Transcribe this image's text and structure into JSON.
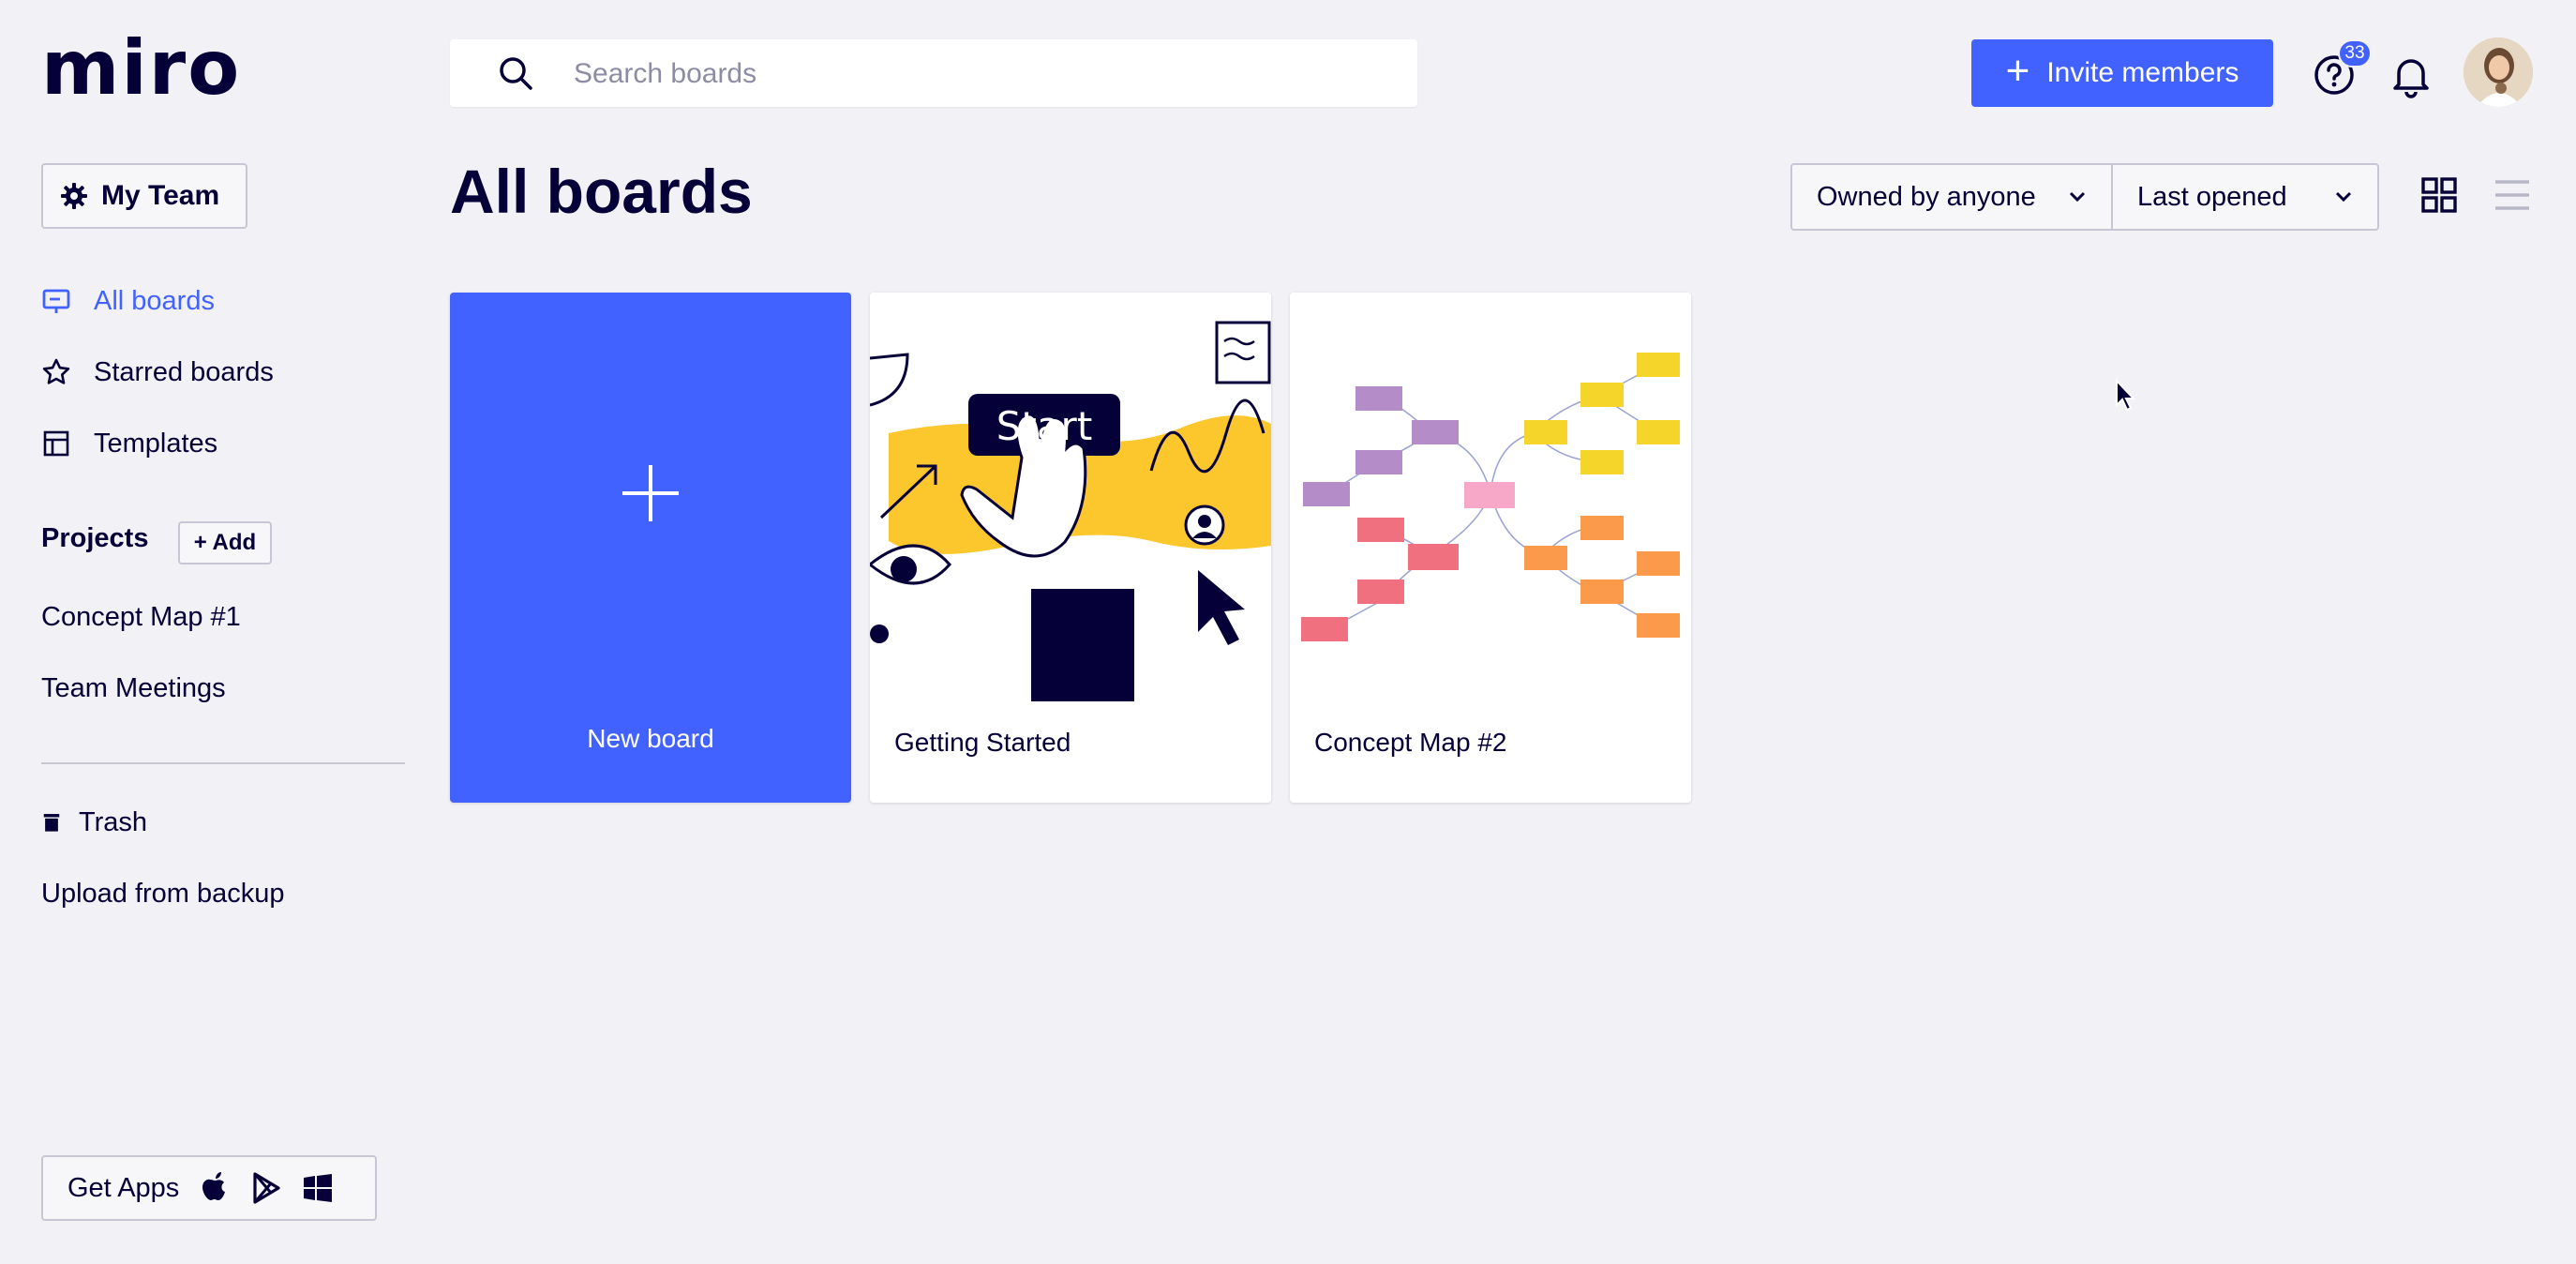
{
  "app": {
    "logo": "miro"
  },
  "header": {
    "search_placeholder": "Search boards",
    "invite_label": "Invite members",
    "help_badge": "33"
  },
  "sidebar": {
    "team_label": "My Team",
    "nav": [
      {
        "label": "All boards",
        "icon": "board-icon",
        "active": true
      },
      {
        "label": "Starred boards",
        "icon": "star-icon"
      },
      {
        "label": "Templates",
        "icon": "template-icon"
      }
    ],
    "projects_title": "Projects",
    "add_label": "+ Add",
    "projects": [
      "Concept Map #1",
      "Team Meetings"
    ],
    "trash_label": "Trash",
    "upload_label": "Upload from backup",
    "get_apps_label": "Get Apps"
  },
  "main": {
    "title": "All boards",
    "owner_filter": "Owned by anyone",
    "sort_filter": "Last opened",
    "cards": [
      {
        "title": "New board"
      },
      {
        "title": "Getting Started",
        "thumb_text": "Start"
      },
      {
        "title": "Concept Map #2"
      }
    ]
  },
  "colors": {
    "accent": "#4262ff",
    "text": "#050038",
    "background": "#f2f2f6"
  }
}
